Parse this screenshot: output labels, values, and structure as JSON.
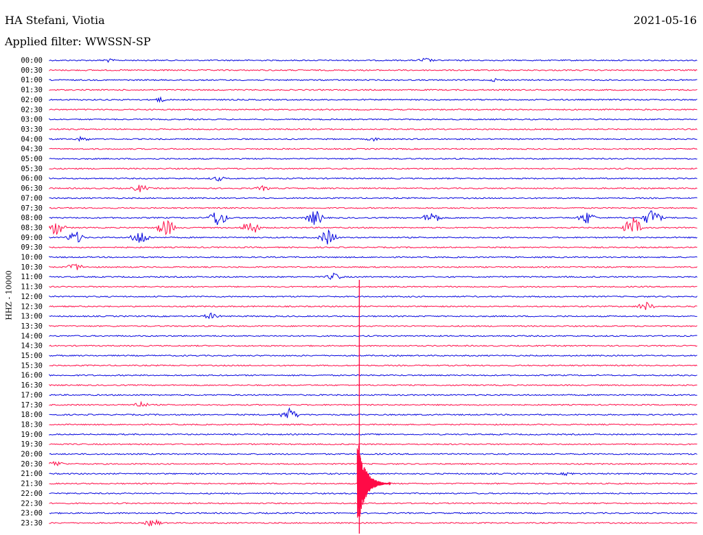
{
  "header": {
    "station": "HA Stefani, Viotia",
    "date": "2021-05-16",
    "filter": "Applied filter: WWSSN-SP"
  },
  "axis": {
    "channel_label": "HHZ - 10000"
  },
  "colors": {
    "line_a": "#0000dd",
    "line_b": "#ff0a46"
  },
  "chart_data": {
    "type": "line",
    "title": "",
    "rows": [
      "00:00",
      "00:30",
      "01:00",
      "01:30",
      "02:00",
      "02:30",
      "03:00",
      "03:30",
      "04:00",
      "04:30",
      "05:00",
      "05:30",
      "06:00",
      "06:30",
      "07:00",
      "07:30",
      "08:00",
      "08:30",
      "09:00",
      "09:30",
      "10:00",
      "10:30",
      "11:00",
      "11:30",
      "12:00",
      "12:30",
      "13:00",
      "13:30",
      "14:00",
      "14:30",
      "15:00",
      "15:30",
      "16:00",
      "16:30",
      "17:00",
      "17:30",
      "18:00",
      "18:30",
      "19:00",
      "19:30",
      "20:00",
      "20:30",
      "21:00",
      "21:30",
      "22:00",
      "22:30",
      "23:00",
      "23:30"
    ],
    "row_colors": [
      "line_a",
      "line_b"
    ],
    "events": [
      {
        "row": "00:00",
        "at": 0.58,
        "amp": 4
      },
      {
        "row": "00:00",
        "at": 0.09,
        "amp": 3
      },
      {
        "row": "01:00",
        "at": 0.69,
        "amp": 3
      },
      {
        "row": "02:00",
        "at": 0.17,
        "amp": 4
      },
      {
        "row": "04:00",
        "at": 0.05,
        "amp": 4
      },
      {
        "row": "04:00",
        "at": 0.5,
        "amp": 3
      },
      {
        "row": "06:00",
        "at": 0.26,
        "amp": 4
      },
      {
        "row": "06:30",
        "at": 0.14,
        "amp": 6
      },
      {
        "row": "06:30",
        "at": 0.33,
        "amp": 4
      },
      {
        "row": "08:00",
        "at": 0.26,
        "amp": 14
      },
      {
        "row": "08:00",
        "at": 0.41,
        "amp": 12
      },
      {
        "row": "08:00",
        "at": 0.59,
        "amp": 10
      },
      {
        "row": "08:00",
        "at": 0.83,
        "amp": 10
      },
      {
        "row": "08:00",
        "at": 0.93,
        "amp": 14
      },
      {
        "row": "08:30",
        "at": 0.01,
        "amp": 12
      },
      {
        "row": "08:30",
        "at": 0.18,
        "amp": 14
      },
      {
        "row": "08:30",
        "at": 0.31,
        "amp": 12
      },
      {
        "row": "08:30",
        "at": 0.9,
        "amp": 16
      },
      {
        "row": "09:00",
        "at": 0.04,
        "amp": 10
      },
      {
        "row": "09:00",
        "at": 0.14,
        "amp": 12
      },
      {
        "row": "09:00",
        "at": 0.43,
        "amp": 12
      },
      {
        "row": "10:30",
        "at": 0.04,
        "amp": 6
      },
      {
        "row": "11:00",
        "at": 0.44,
        "amp": 6
      },
      {
        "row": "12:30",
        "at": 0.92,
        "amp": 7
      },
      {
        "row": "13:00",
        "at": 0.25,
        "amp": 5
      },
      {
        "row": "17:30",
        "at": 0.14,
        "amp": 5
      },
      {
        "row": "18:00",
        "at": 0.37,
        "amp": 10
      },
      {
        "row": "20:30",
        "at": 0.01,
        "amp": 5
      },
      {
        "row": "21:00",
        "at": 0.8,
        "amp": 3
      },
      {
        "row": "23:30",
        "at": 0.16,
        "amp": 6
      }
    ],
    "mainshock": {
      "row": "21:30",
      "at": 0.475,
      "amp": 70
    }
  }
}
